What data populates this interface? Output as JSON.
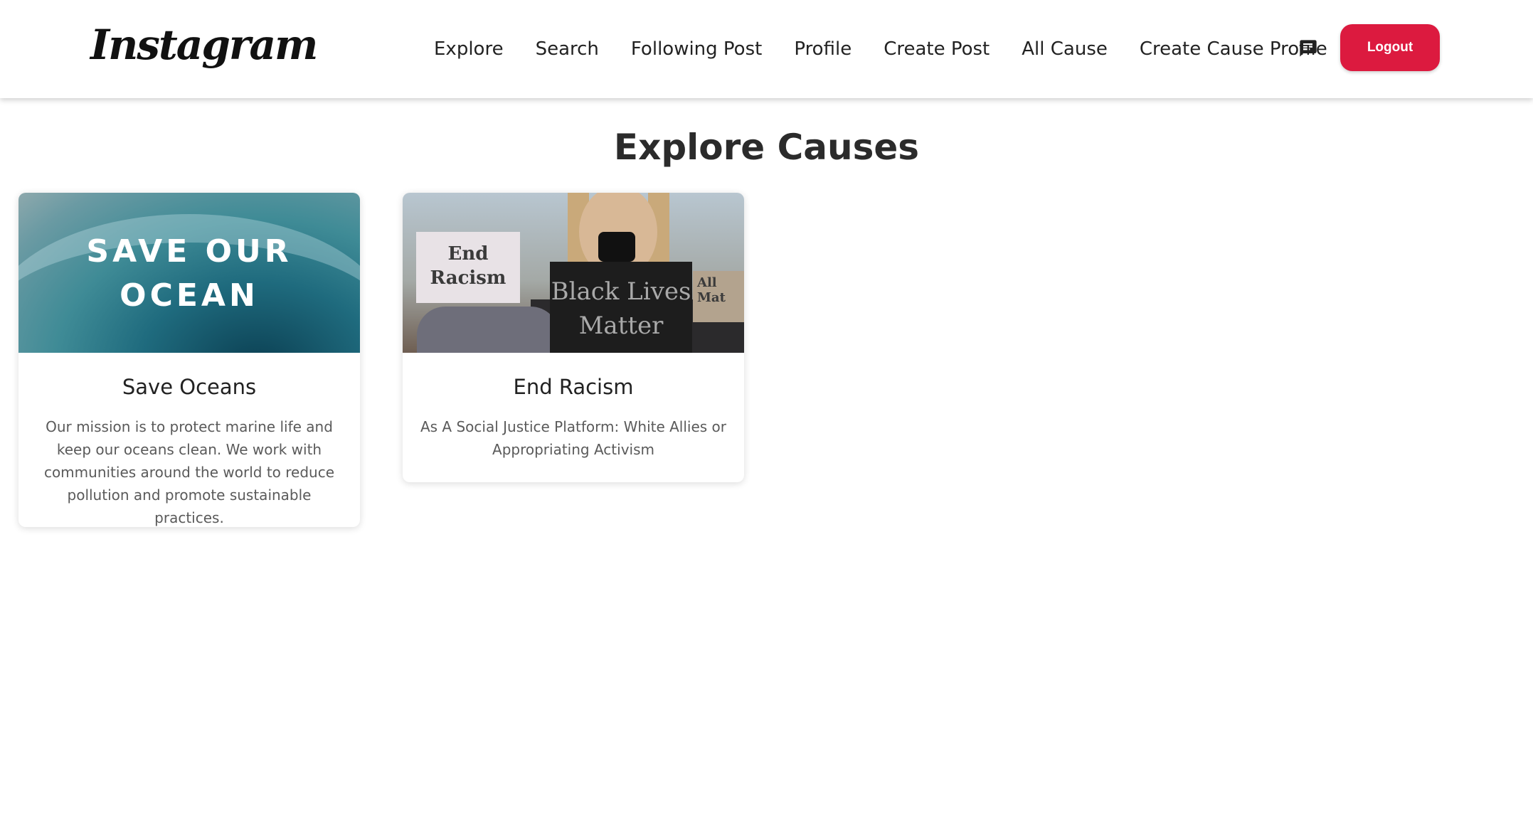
{
  "header": {
    "logo": "Instagram",
    "nav": [
      {
        "label": "Explore"
      },
      {
        "label": "Search"
      },
      {
        "label": "Following Post"
      },
      {
        "label": "Profile"
      },
      {
        "label": "Create Post"
      },
      {
        "label": "All Cause"
      },
      {
        "label": "Create Cause Profile"
      }
    ],
    "message_icon": "message-icon",
    "logout_label": "Logout",
    "logout_color": "#dc1a3f"
  },
  "main": {
    "title": "Explore Causes",
    "causes": [
      {
        "image_text": [
          "SAVE OUR",
          "OCEAN"
        ],
        "title": "Save Oceans",
        "description": "Our mission is to protect marine life and keep our oceans clean. We work with communities around the world to reduce pollution and promote sustainable practices."
      },
      {
        "image_text": {
          "sign_left": [
            "End",
            "Racism"
          ],
          "sign_center": [
            "Black Lives",
            "Matter"
          ],
          "sign_right": [
            "All",
            "Mat"
          ]
        },
        "title": "End Racism",
        "description": "As A Social Justice Platform: White Allies or Appropriating Activism"
      }
    ]
  }
}
